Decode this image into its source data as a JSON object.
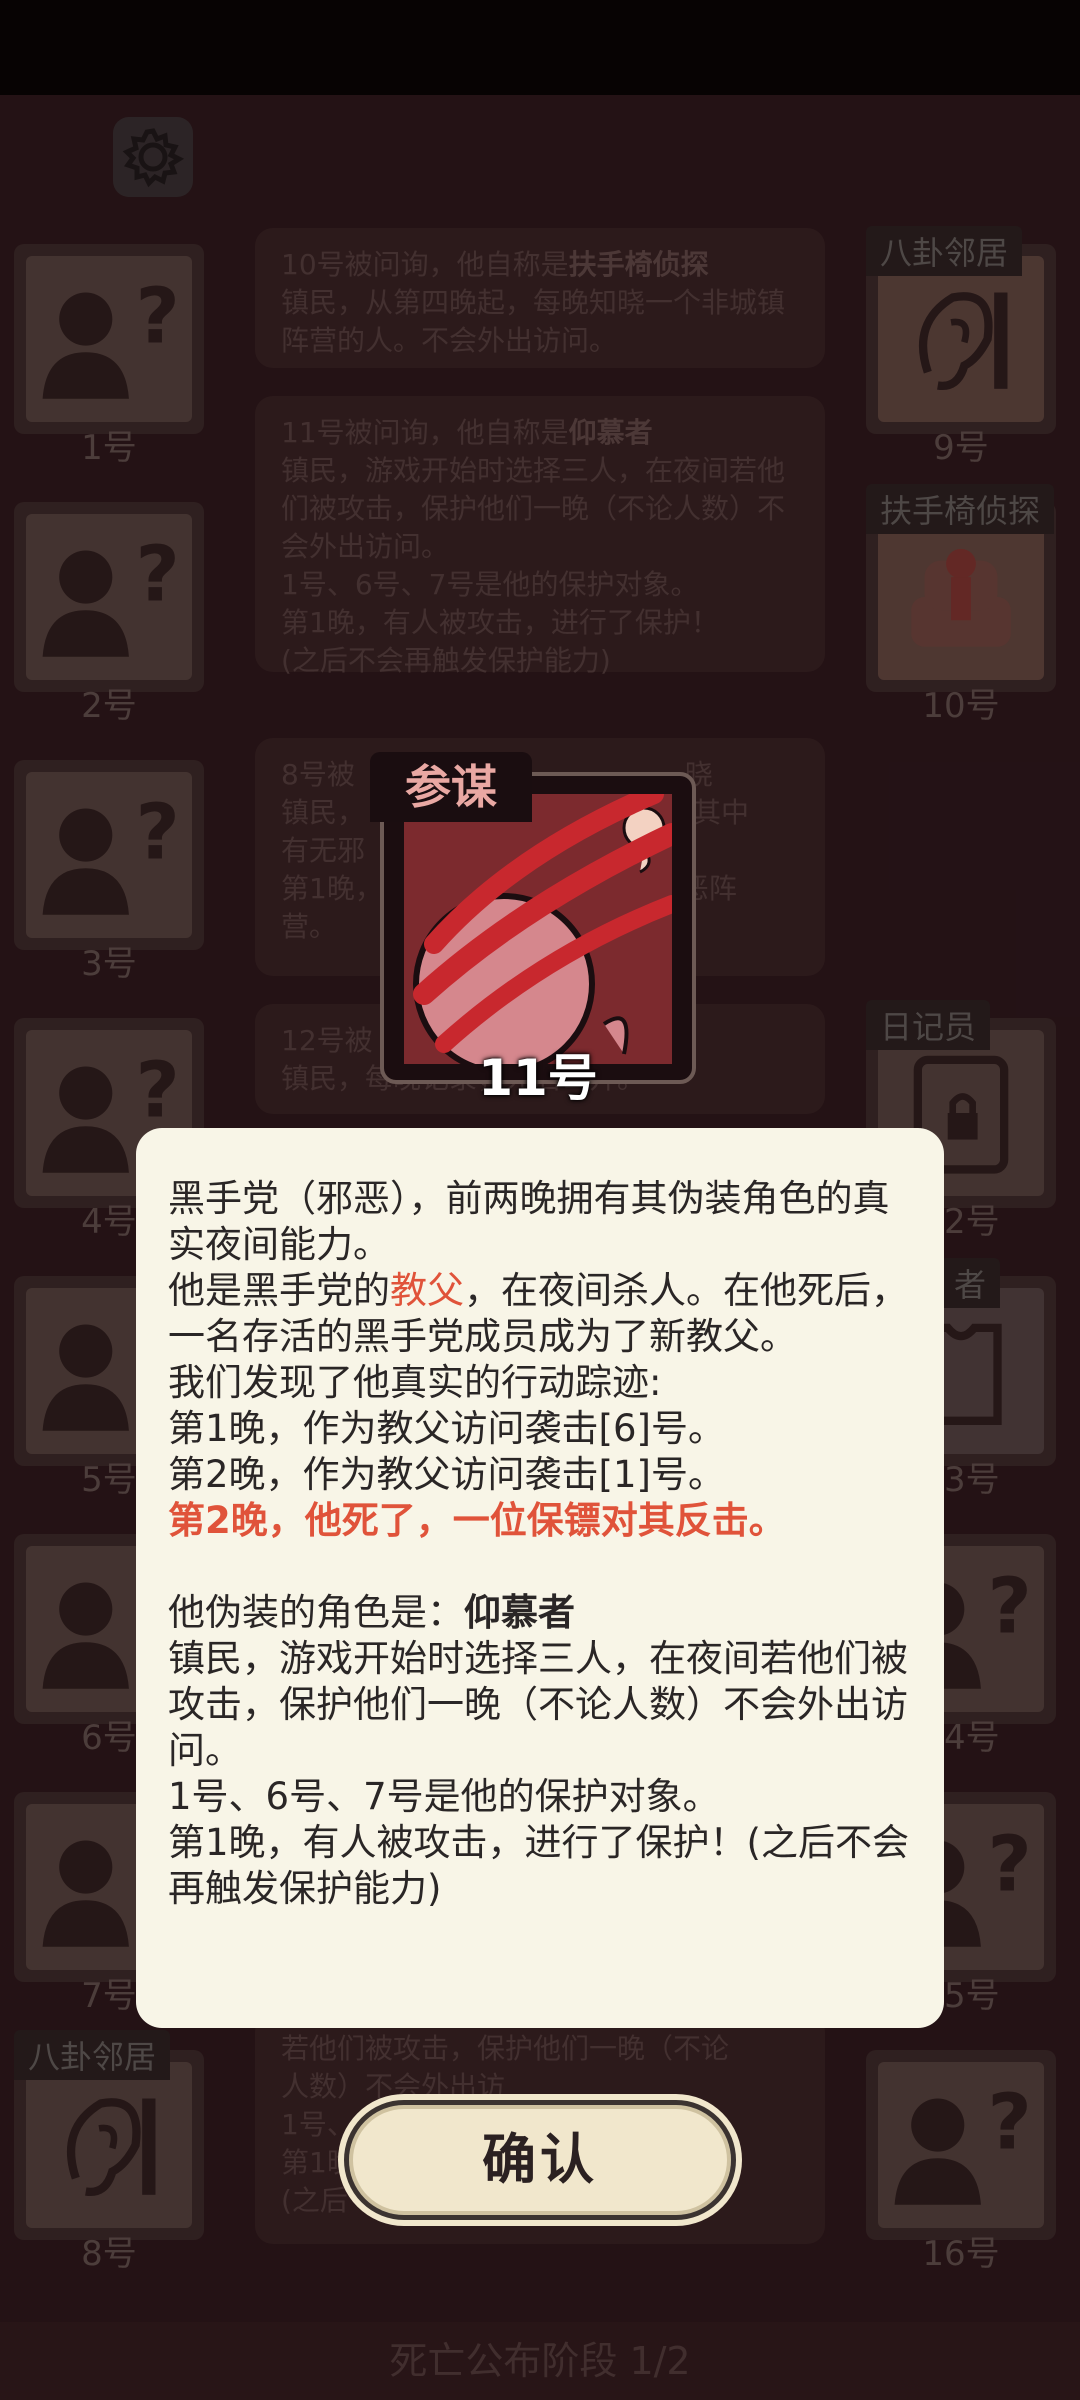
{
  "phase_label": "死亡公布阶段 1/2",
  "left_slots": [
    {
      "number": "1号"
    },
    {
      "number": "2号"
    },
    {
      "number": "3号"
    },
    {
      "number": "4号"
    },
    {
      "number": "5号"
    },
    {
      "number": "6号"
    },
    {
      "number": "7号"
    },
    {
      "number": "8号",
      "tag": "八卦邻居"
    }
  ],
  "right_slots": [
    {
      "number": "9号",
      "tag": "八卦邻居"
    },
    {
      "number": "10号",
      "tag": "扶手椅侦探"
    },
    {
      "number": "12号",
      "tag": "日记员"
    },
    {
      "number": "13号",
      "tag": "者"
    },
    {
      "number": "14号"
    },
    {
      "number": "15号"
    },
    {
      "number": "16号"
    }
  ],
  "log": {
    "entry1": {
      "line1_pre": "10号被问询，他自称是",
      "line1_role": "扶手椅侦探",
      "rest": "镇民，从第四晚起，每晚知晓一个非城镇阵营的人。不会外出访问。"
    },
    "entry2": {
      "line1_pre": "11号被问询，他自称是",
      "line1_role": "仰慕者",
      "rest": "镇民，游戏开始时选择三人，在夜间若他们被攻击，保护他们一晚（不论人数）不会外出访问。",
      "line2": "1号、6号、7号是他的保护对象。",
      "line3": "第1晚，有人被攻击，进行了保护！",
      "line4": "(之后不会再触发保护能力)"
    },
    "entry3": {
      "line1": "8号被",
      "line1b": "晓",
      "line2": "镇民，",
      "line2b": "晓其中",
      "line3": "有无邪",
      "line4": "第1晚，",
      "line4b": "邪恶阵",
      "line5": "营。"
    },
    "entry4": {
      "line1": "12号被",
      "line2": "镇民，每晚记录",
      "line2b": "，死后公开。"
    },
    "entry5": {
      "line1": "若他们被攻击，保护他们一晚（不论",
      "line2": "人数）不会外出访",
      "line3": "1号、",
      "line4": "第1晚",
      "line5": "(之后"
    }
  },
  "card": {
    "role_tag": "参谋",
    "player_number": "11号"
  },
  "dialog": {
    "p1": "黑手党（邪恶），前两晚拥有其伪装角色的真实夜间能力。",
    "p2_pre": "他是黑手党的",
    "p2_hl": "教父",
    "p2_post": "，在夜间杀人。在他死后，一名存活的黑手党成员成为了新教父。",
    "p3": "我们发现了他真实的行动踪迹:",
    "p4": "第1晚，作为教父访问袭击[6]号。",
    "p5": "第2晚，作为教父访问袭击[1]号。",
    "p6": "第2晚，他死了，一位保镖对其反击。",
    "p7_pre": "他伪装的角色是：",
    "p7_role": "仰慕者",
    "p8": "镇民，游戏开始时选择三人，在夜间若他们被攻击，保护他们一晚（不论人数）不会外出访问。",
    "p9": "1号、6号、7号是他的保护对象。",
    "p10": "第1晚，有人被攻击，进行了保护！(之后不会再触发保护能力)"
  },
  "confirm_label": "确认",
  "colors": {
    "highlight": "#e0533a",
    "dialog_bg": "#f8f5e7",
    "card_tag_text": "#e9a8a3"
  }
}
